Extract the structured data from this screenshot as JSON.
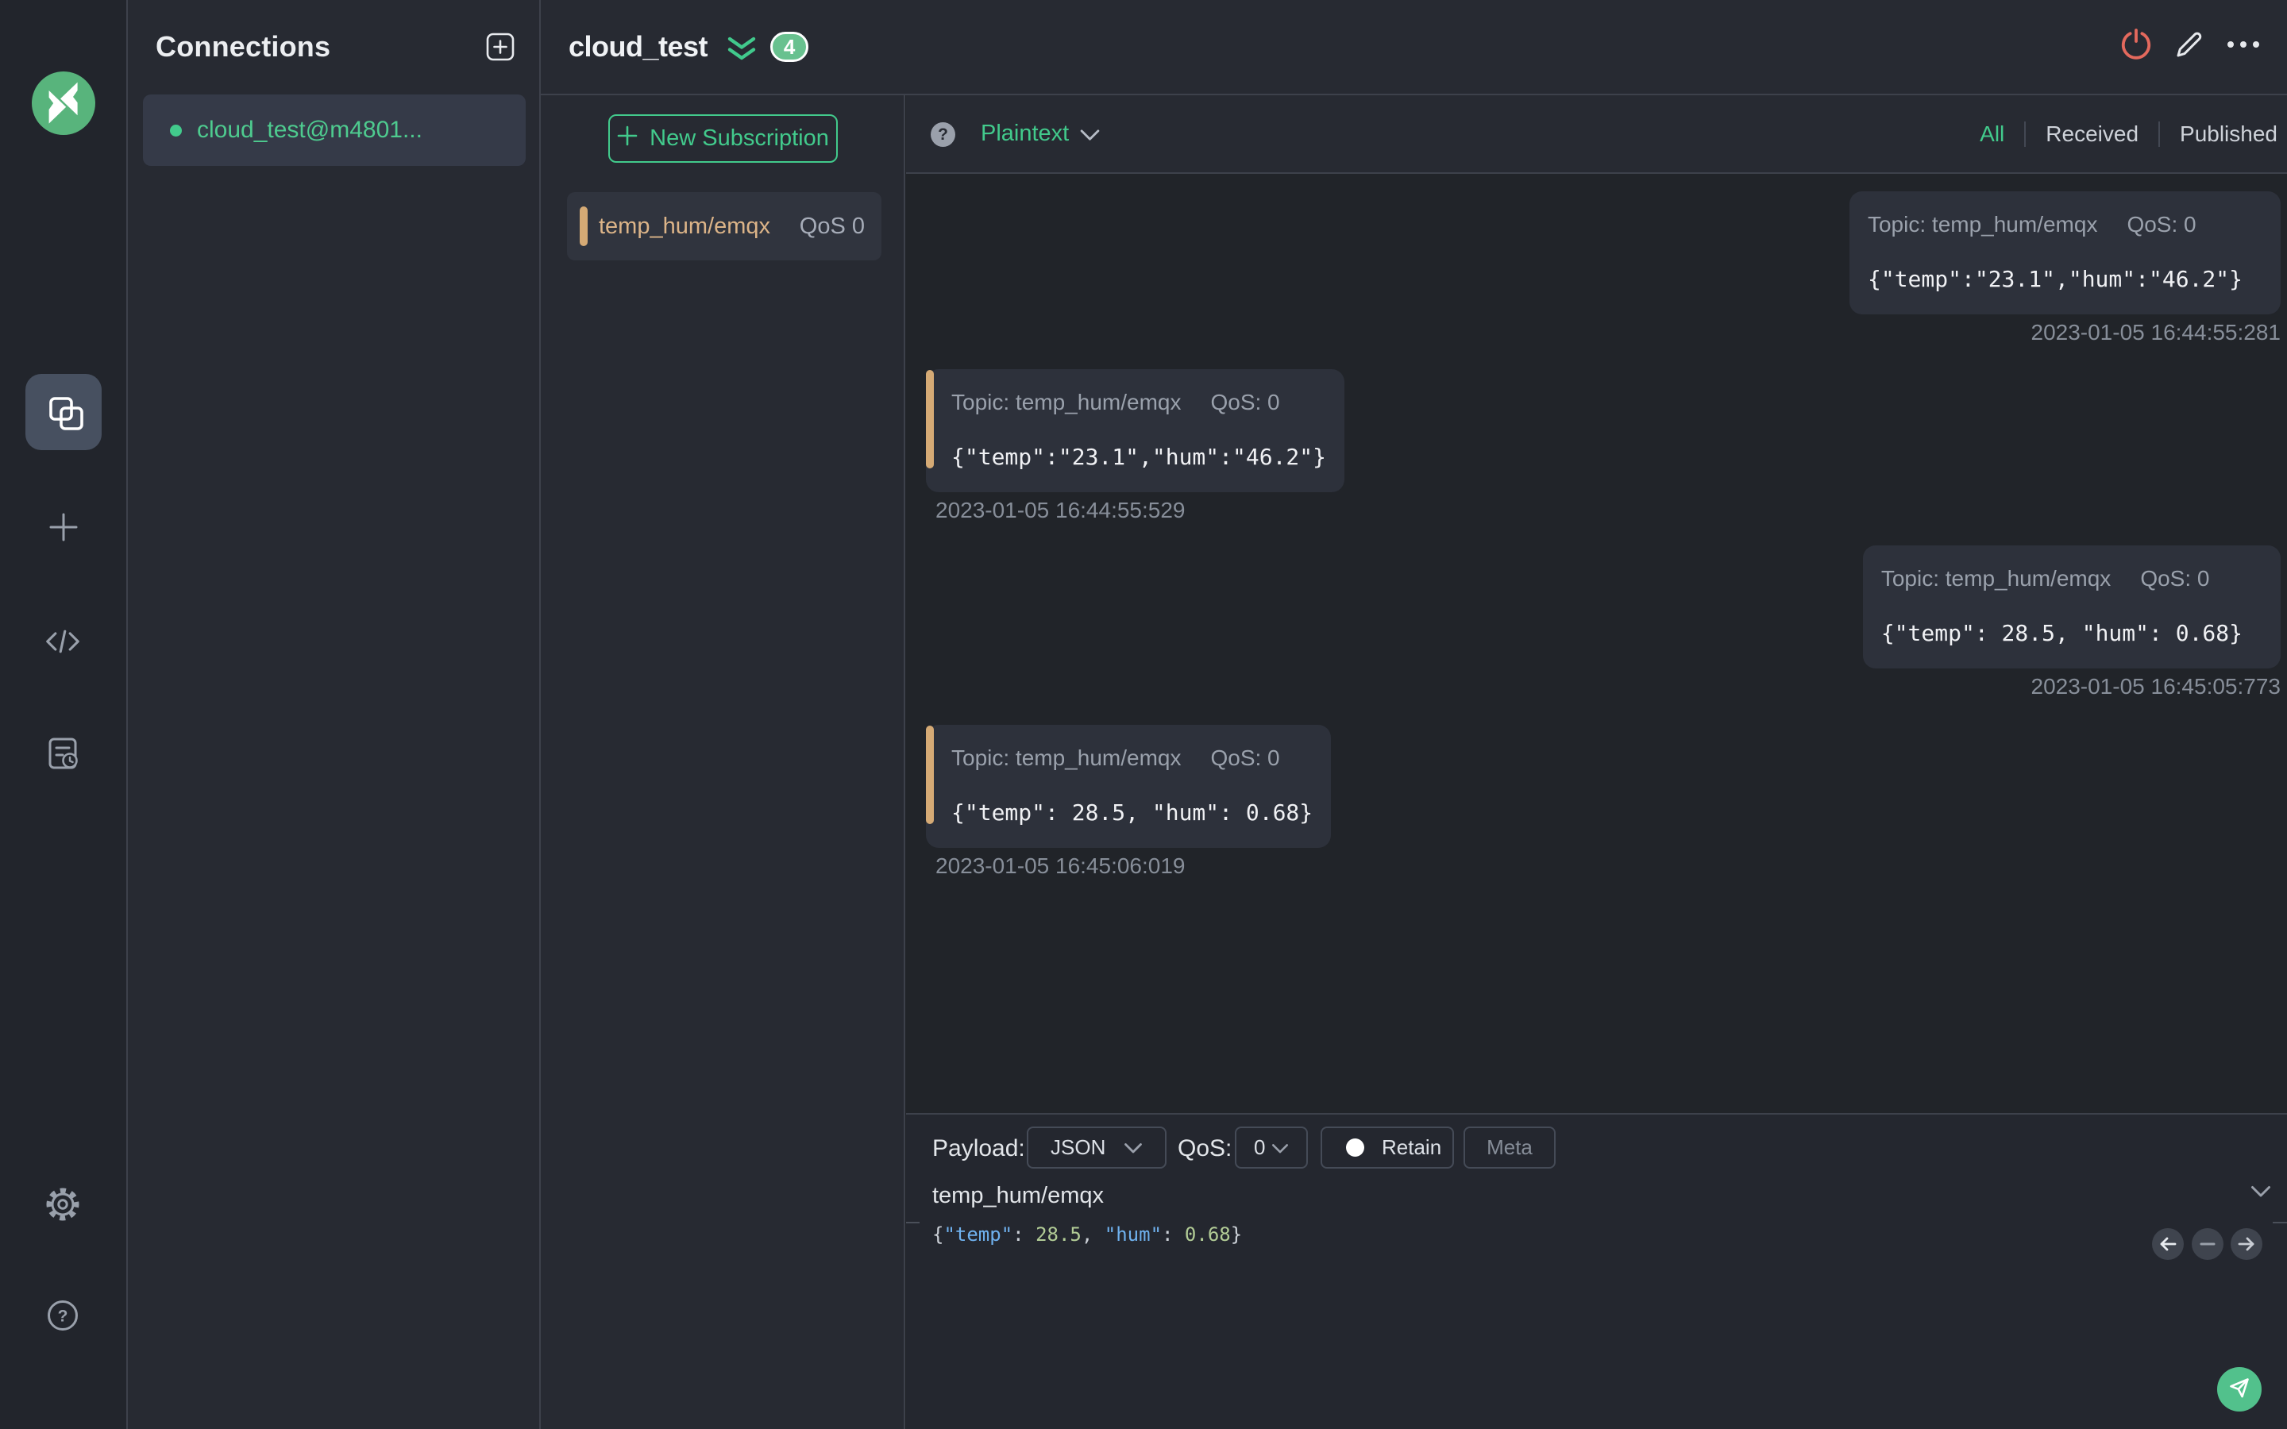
{
  "app": {
    "name": "MQTTX"
  },
  "colors": {
    "accent": "#42ca8c",
    "logo-green": "#58b47c",
    "badge": "#68c18f",
    "tan": "#d5aa75",
    "send-green": "#52c18c",
    "red": "#e4695d"
  },
  "sidebar": {
    "icons": [
      "mqttx-logo",
      "connections",
      "new-connection-plus",
      "script",
      "log",
      "settings",
      "help"
    ],
    "active_item": "connections"
  },
  "connections_panel": {
    "title": "Connections",
    "items": [
      {
        "name": "cloud_test@m4801...",
        "status": "connected"
      }
    ]
  },
  "header": {
    "title": "cloud_test",
    "subscription_count_badge": "4"
  },
  "subscriptions": {
    "new_button_label": "New Subscription",
    "items": [
      {
        "topic": "temp_hum/emqx",
        "qos_label": "QoS 0"
      }
    ]
  },
  "messages": {
    "format_label": "Plaintext",
    "filters": {
      "all": "All",
      "received": "Received",
      "published": "Published",
      "active": "All"
    },
    "items": [
      {
        "direction": "published",
        "topic_label": "Topic: temp_hum/emqx",
        "qos_label": "QoS: 0",
        "payload": "{\"temp\":\"23.1\",\"hum\":\"46.2\"}",
        "timestamp": "2023-01-05 16:44:55:281"
      },
      {
        "direction": "received",
        "topic_label": "Topic: temp_hum/emqx",
        "qos_label": "QoS: 0",
        "payload": "{\"temp\":\"23.1\",\"hum\":\"46.2\"}",
        "timestamp": "2023-01-05 16:44:55:529"
      },
      {
        "direction": "published",
        "topic_label": "Topic: temp_hum/emqx",
        "qos_label": "QoS: 0",
        "payload": "{\"temp\": 28.5, \"hum\": 0.68}",
        "timestamp": "2023-01-05 16:45:05:773"
      },
      {
        "direction": "received",
        "topic_label": "Topic: temp_hum/emqx",
        "qos_label": "QoS: 0",
        "payload": "{\"temp\": 28.5, \"hum\": 0.68}",
        "timestamp": "2023-01-05 16:45:06:019"
      }
    ]
  },
  "publish": {
    "payload_label": "Payload:",
    "payload_format": "JSON",
    "qos_label": "QoS:",
    "qos_value": "0",
    "retain_label": "Retain",
    "meta_label": "Meta",
    "topic_value": "temp_hum/emqx",
    "payload_value": "{\"temp\": 28.5, \"hum\": 0.68}",
    "payload_tokens": [
      {
        "text": "{",
        "type": "punct"
      },
      {
        "text": "\"temp\"",
        "type": "key"
      },
      {
        "text": ": ",
        "type": "punct"
      },
      {
        "text": "28.5",
        "type": "num"
      },
      {
        "text": ", ",
        "type": "punct"
      },
      {
        "text": "\"hum\"",
        "type": "key"
      },
      {
        "text": ": ",
        "type": "punct"
      },
      {
        "text": "0.68",
        "type": "num"
      },
      {
        "text": "}",
        "type": "punct"
      }
    ]
  }
}
